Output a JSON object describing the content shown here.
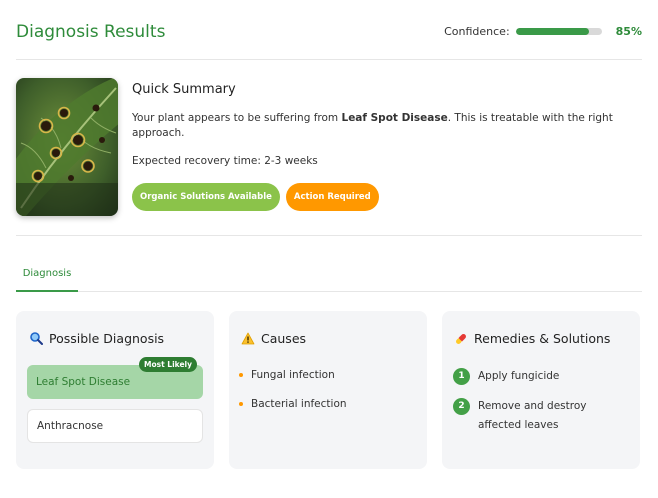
{
  "header": {
    "title": "Diagnosis Results",
    "confidence_label": "Confidence:",
    "confidence_value": "85%",
    "confidence_fraction": 0.85,
    "accent": "#2e8b3a"
  },
  "summary": {
    "image_alt": "leaf-with-spots",
    "title": "Quick Summary",
    "line1_pre": "Your plant appears to be suffering from ",
    "line1_bold": "Leaf Spot Disease",
    "line1_post": ". This is treatable with the right approach.",
    "recovery": "Expected recovery time: 2-3 weeks",
    "badges": [
      {
        "label": "Organic Solutions Available",
        "color": "#8bc34a"
      },
      {
        "label": "Action Required",
        "color": "#ff9800"
      }
    ]
  },
  "tabs": [
    {
      "label": "Diagnosis",
      "active": true
    }
  ],
  "cards": {
    "diagnosis": {
      "icon": "magnifier-icon",
      "title": "Possible Diagnosis",
      "items": [
        {
          "label": "Leaf Spot Disease",
          "tag": "Most Likely"
        },
        {
          "label": "Anthracnose"
        }
      ]
    },
    "causes": {
      "icon": "warning-icon",
      "title": "Causes",
      "items": [
        "Fungal infection",
        "Bacterial infection"
      ]
    },
    "remedies": {
      "icon": "pill-icon",
      "title": "Remedies & Solutions",
      "steps": [
        {
          "num": "1",
          "text": "Apply fungicide"
        },
        {
          "num": "2",
          "text": "Remove and destroy affected leaves"
        }
      ]
    }
  }
}
